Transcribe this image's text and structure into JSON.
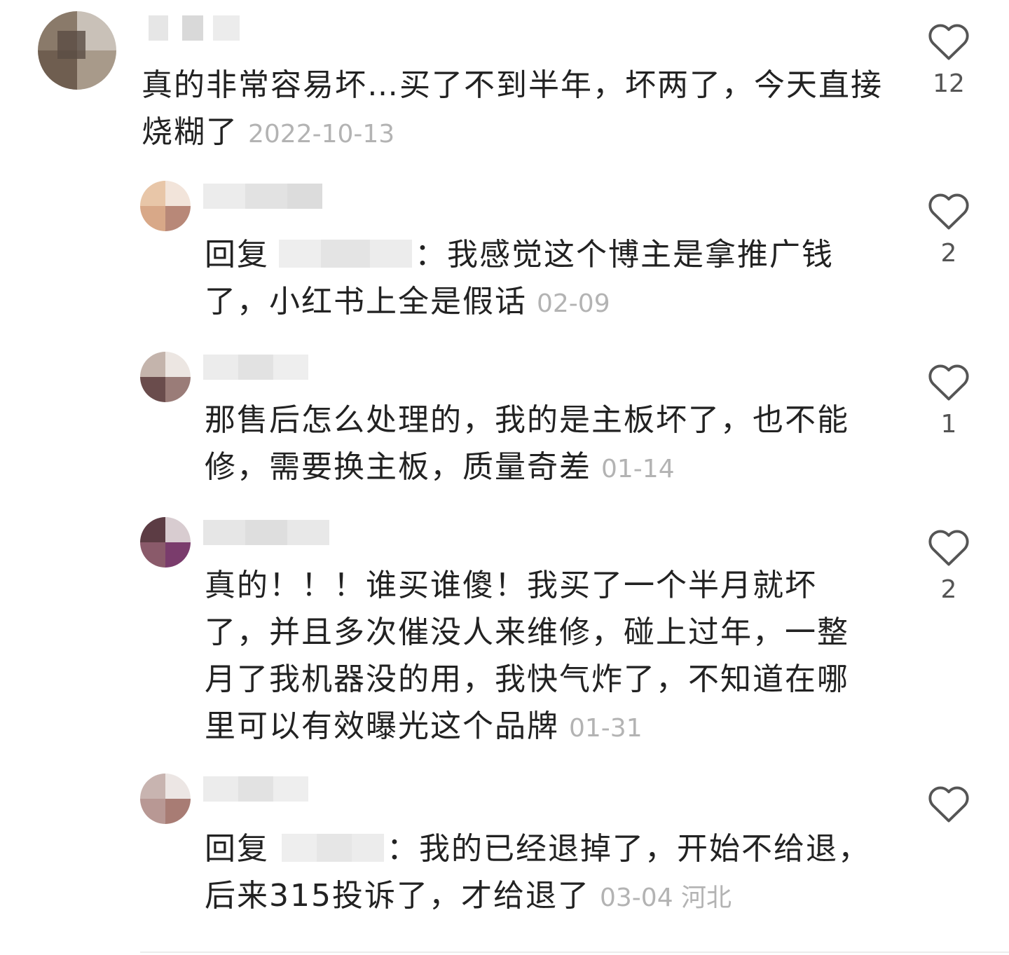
{
  "comments": [
    {
      "level": "top",
      "username": "",
      "text": "真的非常容易坏…买了不到半年，坏两了，今天直接烧糊了",
      "date": "2022-10-13",
      "location": "",
      "likes": "12"
    },
    {
      "level": "reply",
      "username": "",
      "reply_prefix": "回复",
      "reply_to": "",
      "reply_colon": "：",
      "text": "我感觉这个博主是拿推广钱了，小红书上全是假话",
      "date": "02-09",
      "location": "",
      "likes": "2"
    },
    {
      "level": "reply",
      "username": "",
      "text": "那售后怎么处理的，我的是主板坏了，也不能修，需要换主板，质量奇差",
      "date": "01-14",
      "location": "",
      "likes": "1"
    },
    {
      "level": "reply",
      "username": "",
      "text": "真的！！！谁买谁傻！我买了一个半月就坏了，并且多次催没人来维修，碰上过年，一整月了我机器没的用，我快气炸了，不知道在哪里可以有效曝光这个品牌",
      "date": "01-31",
      "location": "",
      "likes": "2"
    },
    {
      "level": "reply",
      "username": "",
      "reply_prefix": "回复",
      "reply_to": "",
      "reply_colon": "：",
      "text": "我的已经退掉了，开始不给退，后来315投诉了，才给退了",
      "date": "03-04",
      "location": "河北",
      "likes": ""
    }
  ],
  "colors": {
    "text": "#222222",
    "meta": "#b3b3b3",
    "heart_stroke": "#555555"
  },
  "icons": {
    "like": "heart-outline-icon"
  }
}
